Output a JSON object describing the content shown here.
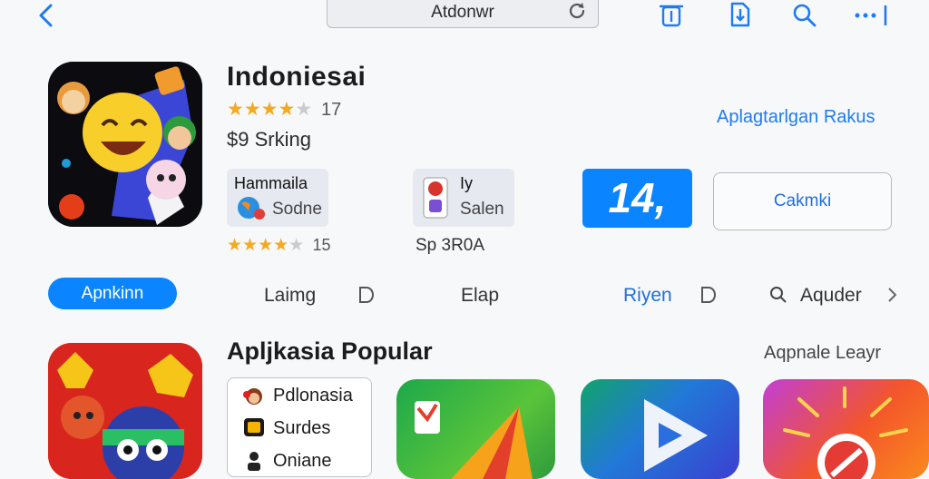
{
  "topbar": {
    "url_text": "Atdonwr",
    "icons": [
      "chevron-left-icon",
      "reload-icon",
      "trash-icon",
      "share-icon",
      "search-icon",
      "more-icon"
    ]
  },
  "app": {
    "title": "Indoniesai",
    "rating_count": "17",
    "price_text": "$9 Srking",
    "link_text": "Aplagtarlgan Rakus",
    "card1": {
      "title": "Hammaila",
      "subtitle": "Sodne"
    },
    "card2": {
      "title": "Iy",
      "subtitle": "Salen"
    },
    "rating2_count": "15",
    "size_text": "Sp 3R0A",
    "big_button": "14,",
    "outline_button": "Cakmki",
    "rating1_value": 4,
    "rating2_value": 4
  },
  "tabs": {
    "active": "Apnkinn",
    "items": [
      "Laimg",
      "Elap",
      "Riyen",
      "Aquder"
    ]
  },
  "section": {
    "title": "Apljkasia Popular",
    "right_link": "Aqpnale Leayr",
    "list": [
      "Pdlonasia",
      "Surdes",
      "Oniane"
    ]
  },
  "colors": {
    "accent": "#0a84ff",
    "star": "#f4a920",
    "background": "#f7f8fa"
  }
}
